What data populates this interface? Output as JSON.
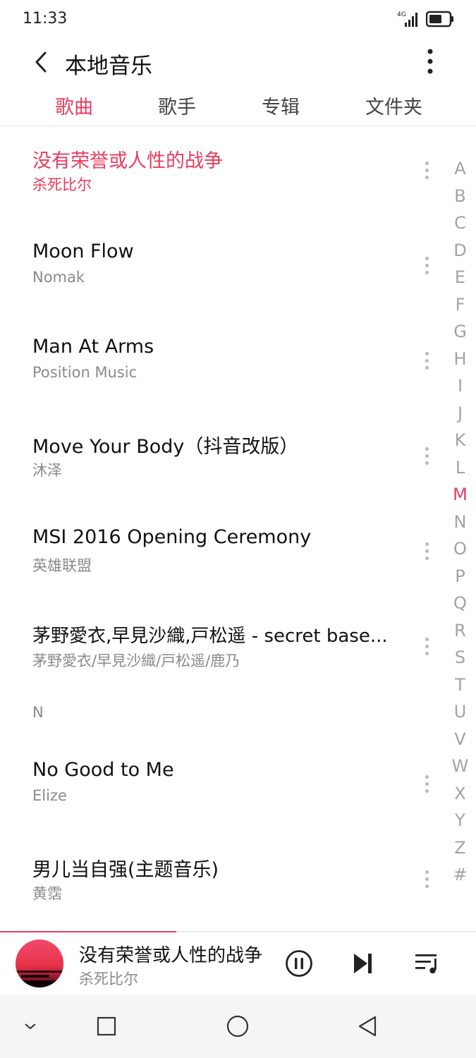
{
  "status_bar": {
    "time": "11:33",
    "network": "4G"
  },
  "header": {
    "title": "本地音乐"
  },
  "tabs": [
    {
      "label": "歌曲",
      "active": true
    },
    {
      "label": "歌手",
      "active": false
    },
    {
      "label": "专辑",
      "active": false
    },
    {
      "label": "文件夹",
      "active": false
    }
  ],
  "songs": [
    {
      "title": "没有荣誉或人性的战争",
      "artist": "杀死比尔",
      "playing": true
    },
    {
      "title": "Moon Flow",
      "artist": "Nomak"
    },
    {
      "title": "Man At Arms",
      "artist": "Position Music"
    },
    {
      "title": "Move Your Body（抖音改版）",
      "artist": "沐泽"
    },
    {
      "title": "MSI 2016 Opening Ceremony",
      "artist": "英雄联盟"
    },
    {
      "title": "茅野愛衣,早見沙織,戸松遥 - secret base...",
      "artist": "茅野愛衣/早見沙織/戸松遥/鹿乃"
    },
    {
      "title": "No Good to Me",
      "artist": "Elize"
    },
    {
      "title": "男儿当自强(主题音乐)",
      "artist": "黄霑"
    }
  ],
  "section_header": "N",
  "alphabet_index": [
    "A",
    "B",
    "C",
    "D",
    "E",
    "F",
    "G",
    "H",
    "I",
    "J",
    "K",
    "L",
    "M",
    "N",
    "O",
    "P",
    "Q",
    "R",
    "S",
    "T",
    "U",
    "V",
    "W",
    "X",
    "Y",
    "Z",
    "#"
  ],
  "alphabet_active": "M",
  "now_playing": {
    "title": "没有荣誉或人性的战争",
    "artist": "杀死比尔",
    "progress": 0.37
  },
  "colors": {
    "accent": "#e83c5e",
    "text_primary": "#111111",
    "text_secondary": "#8a8a8a"
  },
  "icons": {
    "back": "chevron-left-icon",
    "more": "more-vertical-icon",
    "play_pause": "pause-circle-icon",
    "next": "skip-next-icon",
    "playlist": "playlist-icon",
    "nav": [
      "chevron-down-icon",
      "square-icon",
      "circle-icon",
      "triangle-back-icon"
    ]
  }
}
